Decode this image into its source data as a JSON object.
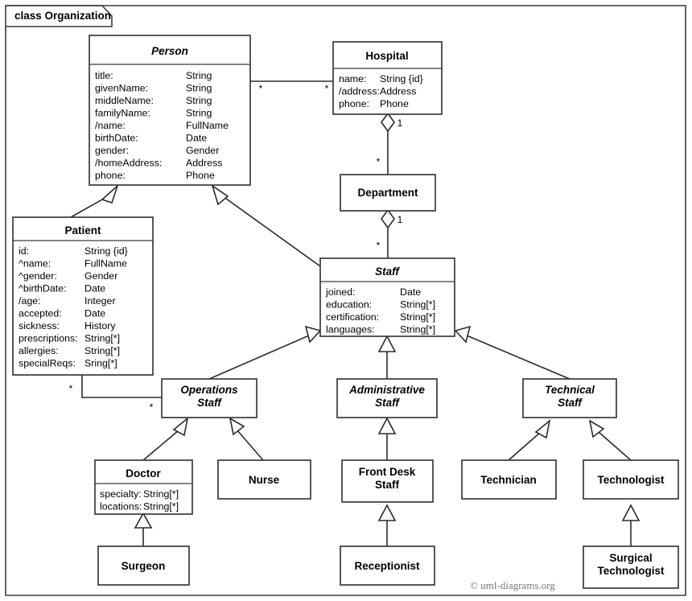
{
  "frame": {
    "label": "class Organization",
    "kind": "class-diagram-frame"
  },
  "copyright": "© uml-diagrams.org",
  "classes": {
    "person": {
      "name": "Person",
      "abstract": true,
      "attributes": [
        {
          "name": "title:",
          "type": "String"
        },
        {
          "name": "givenName:",
          "type": "String"
        },
        {
          "name": "middleName:",
          "type": "String"
        },
        {
          "name": "familyName:",
          "type": "String"
        },
        {
          "name": "/name:",
          "type": "FullName"
        },
        {
          "name": "birthDate:",
          "type": "Date"
        },
        {
          "name": "gender:",
          "type": "Gender"
        },
        {
          "name": "/homeAddress:",
          "type": "Address"
        },
        {
          "name": "phone:",
          "type": "Phone"
        }
      ]
    },
    "hospital": {
      "name": "Hospital",
      "abstract": false,
      "attributes": [
        {
          "name": "name:",
          "type": "String {id}"
        },
        {
          "name": "/address:",
          "type": "Address"
        },
        {
          "name": "phone:",
          "type": "Phone"
        }
      ]
    },
    "department": {
      "name": "Department",
      "abstract": false,
      "attributes": []
    },
    "patient": {
      "name": "Patient",
      "abstract": false,
      "attributes": [
        {
          "name": "id:",
          "type": "String {id}"
        },
        {
          "name": "^name:",
          "type": "FullName"
        },
        {
          "name": "^gender:",
          "type": "Gender"
        },
        {
          "name": "^birthDate:",
          "type": "Date"
        },
        {
          "name": "/age:",
          "type": "Integer"
        },
        {
          "name": "accepted:",
          "type": "Date"
        },
        {
          "name": "sickness:",
          "type": "History"
        },
        {
          "name": "prescriptions:",
          "type": "String[*]"
        },
        {
          "name": "allergies:",
          "type": "String[*]"
        },
        {
          "name": "specialReqs:",
          "type": "Sring[*]"
        }
      ]
    },
    "staff": {
      "name": "Staff",
      "abstract": true,
      "attributes": [
        {
          "name": "joined:",
          "type": "Date"
        },
        {
          "name": "education:",
          "type": "String[*]"
        },
        {
          "name": "certification:",
          "type": "String[*]"
        },
        {
          "name": "languages:",
          "type": "String[*]"
        }
      ]
    },
    "operations_staff": {
      "name": "Operations Staff",
      "name_line1": "Operations",
      "name_line2": "Staff",
      "abstract": true,
      "attributes": []
    },
    "administrative_staff": {
      "name": "Administrative Staff",
      "name_line1": "Administrative",
      "name_line2": "Staff",
      "abstract": true,
      "attributes": []
    },
    "technical_staff": {
      "name": "Technical Staff",
      "name_line1": "Technical",
      "name_line2": "Staff",
      "abstract": true,
      "attributes": []
    },
    "doctor": {
      "name": "Doctor",
      "abstract": false,
      "attributes": [
        {
          "name": "specialty:",
          "type": "String[*]"
        },
        {
          "name": "locations:",
          "type": "String[*]"
        }
      ]
    },
    "nurse": {
      "name": "Nurse",
      "abstract": false,
      "attributes": []
    },
    "front_desk_staff": {
      "name": "Front Desk Staff",
      "name_line1": "Front Desk",
      "name_line2": "Staff",
      "abstract": false,
      "attributes": []
    },
    "technician": {
      "name": "Technician",
      "abstract": false,
      "attributes": []
    },
    "technologist": {
      "name": "Technologist",
      "abstract": false,
      "attributes": []
    },
    "surgeon": {
      "name": "Surgeon",
      "abstract": false,
      "attributes": []
    },
    "receptionist": {
      "name": "Receptionist",
      "abstract": false,
      "attributes": []
    },
    "surgical_technologist": {
      "name": "Surgical Technologist",
      "name_line1": "Surgical",
      "name_line2": "Technologist",
      "abstract": false,
      "attributes": []
    }
  },
  "relationships": [
    {
      "id": "person-hospital",
      "type": "association",
      "from": "person",
      "to": "hospital",
      "from_multiplicity": "*",
      "to_multiplicity": "*"
    },
    {
      "id": "hospital-department",
      "type": "aggregation",
      "from": "hospital",
      "to": "department",
      "from_multiplicity": "1",
      "to_multiplicity": "*"
    },
    {
      "id": "department-staff",
      "type": "aggregation",
      "from": "department",
      "to": "staff",
      "from_multiplicity": "1",
      "to_multiplicity": "*"
    },
    {
      "id": "patient-operations-staff",
      "type": "association",
      "from": "patient",
      "to": "operations_staff",
      "from_multiplicity": "*",
      "to_multiplicity": "*"
    },
    {
      "id": "patient-person",
      "type": "generalization",
      "from": "patient",
      "to": "person"
    },
    {
      "id": "staff-person",
      "type": "generalization",
      "from": "staff",
      "to": "person"
    },
    {
      "id": "operations-staff",
      "type": "generalization",
      "from": "operations_staff",
      "to": "staff"
    },
    {
      "id": "administrative-staff",
      "type": "generalization",
      "from": "administrative_staff",
      "to": "staff"
    },
    {
      "id": "technical-staff",
      "type": "generalization",
      "from": "technical_staff",
      "to": "staff"
    },
    {
      "id": "doctor-operations",
      "type": "generalization",
      "from": "doctor",
      "to": "operations_staff"
    },
    {
      "id": "nurse-operations",
      "type": "generalization",
      "from": "nurse",
      "to": "operations_staff"
    },
    {
      "id": "frontdesk-administrative",
      "type": "generalization",
      "from": "front_desk_staff",
      "to": "administrative_staff"
    },
    {
      "id": "technician-technical",
      "type": "generalization",
      "from": "technician",
      "to": "technical_staff"
    },
    {
      "id": "technologist-technical",
      "type": "generalization",
      "from": "technologist",
      "to": "technical_staff"
    },
    {
      "id": "surgeon-doctor",
      "type": "generalization",
      "from": "surgeon",
      "to": "doctor"
    },
    {
      "id": "receptionist-frontdesk",
      "type": "generalization",
      "from": "receptionist",
      "to": "front_desk_staff"
    },
    {
      "id": "surgical-technologist",
      "type": "generalization",
      "from": "surgical_technologist",
      "to": "technologist"
    }
  ],
  "multiplicity_labels": {
    "person_end": "*",
    "hospital_left_end": "*",
    "hospital_bottom_end": "1",
    "department_top_end": "*",
    "department_bottom_end": "1",
    "staff_top_end": "*",
    "patient_end": "*",
    "operations_end": "*"
  }
}
